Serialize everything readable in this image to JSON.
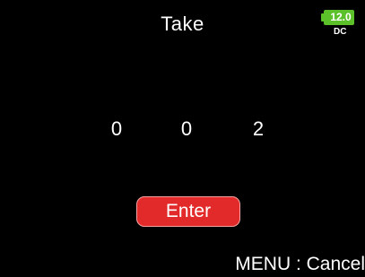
{
  "header": {
    "title": "Take"
  },
  "power": {
    "voltage": "12.0",
    "source": "DC",
    "battery_color": "#5cc02a"
  },
  "take_number": {
    "digits": [
      "0",
      "0",
      "2"
    ]
  },
  "actions": {
    "enter_label": "Enter",
    "enter_color": "#e22a2a",
    "menu_hint": "MENU : Cancel"
  }
}
